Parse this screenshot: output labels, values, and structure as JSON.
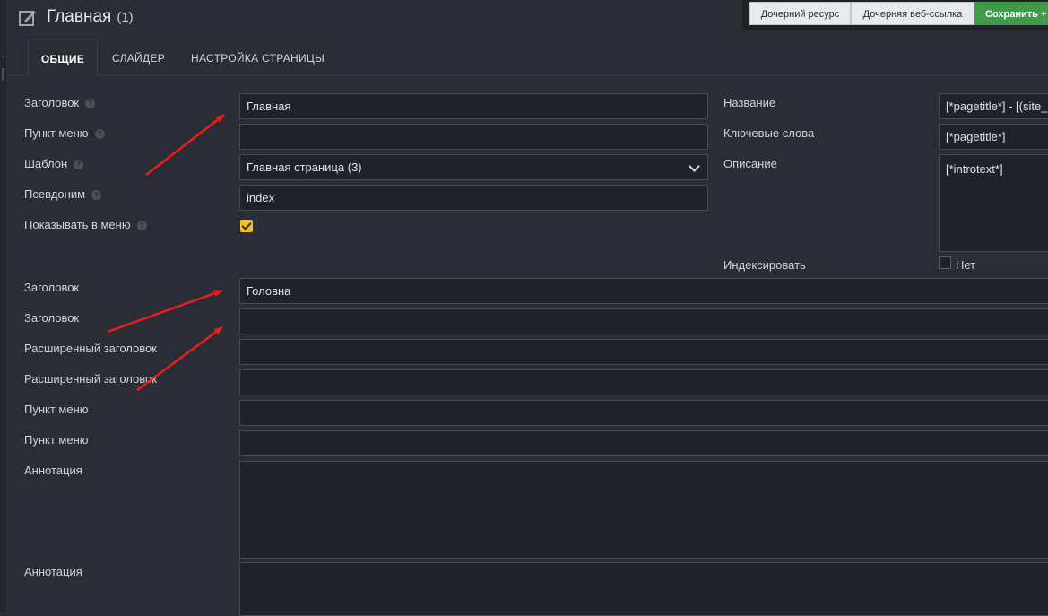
{
  "header": {
    "title": "Главная",
    "count": "(1)"
  },
  "toolbar": {
    "child_resource": "Дочерний ресурс",
    "child_weblink": "Дочерняя веб-ссылка",
    "save": "Сохранить +"
  },
  "tabs": [
    {
      "label": "ОБЩИЕ",
      "active": true
    },
    {
      "label": "СЛАЙДЕР",
      "active": false
    },
    {
      "label": "НАСТРОЙКА СТРАНИЦЫ",
      "active": false
    }
  ],
  "left_form": {
    "pagetitle_label": "Заголовок",
    "pagetitle_value": "Главная",
    "menutitle_label": "Пункт меню",
    "menutitle_value": "",
    "template_label": "Шаблон",
    "template_value": "Главная страница (3)",
    "alias_label": "Псевдоним",
    "alias_value": "index",
    "show_in_menu_label": "Показывать в меню",
    "show_in_menu_checked": true
  },
  "seo_form": {
    "name_label": "Название",
    "name_value": "[*pagetitle*] - [(site_",
    "keywords_label": "Ключевые слова",
    "keywords_value": "[*pagetitle*]",
    "description_label": "Описание",
    "description_value": "[*introtext*]",
    "index_label": "Индексировать",
    "index_option": "Нет",
    "index_checked": false
  },
  "lang_fields": [
    {
      "label": "Заголовок",
      "value": "Головна"
    },
    {
      "label": "Заголовок",
      "value": ""
    },
    {
      "label": "Расширенный заголовок",
      "value": ""
    },
    {
      "label": "Расширенный заголовок",
      "value": ""
    },
    {
      "label": "Пункт меню",
      "value": ""
    },
    {
      "label": "Пункт меню",
      "value": ""
    },
    {
      "label": "Аннотация",
      "value": ""
    },
    {
      "label": "Аннотация",
      "value": ""
    }
  ],
  "colors": {
    "background": "#2a2d35",
    "input_bg": "#1f2228",
    "save_green": "#3f9a4a",
    "checkbox_yellow": "#f4c21f",
    "arrow_red": "#e8201c"
  }
}
